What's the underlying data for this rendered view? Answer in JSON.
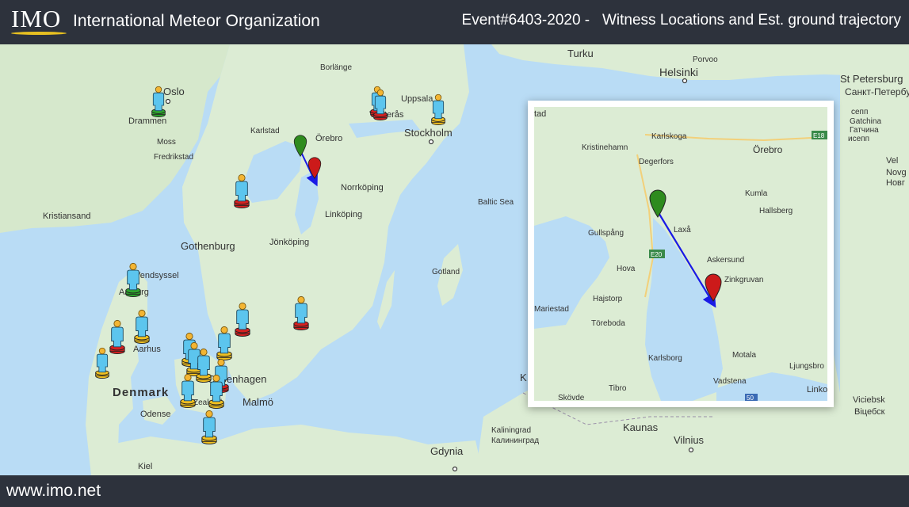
{
  "header": {
    "logo": "IMO",
    "org_name": "International Meteor Organization",
    "event_title": "Event#6403-2020 -   Witness Locations and Est. ground trajectory"
  },
  "footer": {
    "url": "www.imo.net"
  },
  "map": {
    "labels": {
      "turku": "Turku",
      "helsinki": "Helsinki",
      "porvoo": "Porvoo",
      "st_petersburg": "St Petersburg",
      "st_petersburg_ru": "Санкт-Петербург",
      "oslo": "Oslo",
      "drammen": "Drammen",
      "moss": "Moss",
      "fredrikstad": "Fredrikstad",
      "borlange": "Borlänge",
      "karlstad": "Karlstad",
      "orebro": "Örebro",
      "uppsala": "Uppsala",
      "vasteras": "Västerås",
      "stockholm": "Stockholm",
      "norrkoping": "Norrköping",
      "linkoping": "Linköping",
      "kristiansand": "Kristiansand",
      "baltic_sea": "Baltic Sea",
      "gothenburg": "Gothenburg",
      "jonkoping": "Jönköping",
      "gotland": "Gotland",
      "vendsyssel": "Vendsyssel",
      "aalborg": "Aalborg",
      "aarhus": "Aarhus",
      "denmark": "Denmark",
      "copenhagen": "Copenhagen",
      "malmo": "Malmö",
      "odense": "Odense",
      "zealand": "Zealand",
      "kiel": "Kiel",
      "gdynia": "Gdynia",
      "kaliningrad": "Kaliningrad",
      "kaliningrad_ru": "Калининград",
      "kaunas": "Kaunas",
      "vilnius": "Vilnius",
      "viciebsk": "Viciebsk",
      "viciebsk_by": "Віцебск",
      "edge_k": "K",
      "sepp": "сепп",
      "gatchina": "Gatchina",
      "gatchina_ru": "Гатчина",
      "visepp": "исепп",
      "vel": "Vel",
      "novg": "Novg",
      "novg_ru": "Новг"
    },
    "witness_colors": {
      "green": "#2ea62e",
      "red": "#d82020",
      "yellow": "#f0c020"
    }
  },
  "inset": {
    "labels": {
      "karlstad_edge": "tad",
      "karlskoga": "Karlskoga",
      "kristinehamn": "Kristinehamn",
      "degerfors": "Degerfors",
      "orebro": "Örebro",
      "kumla": "Kumla",
      "hallsberg": "Hallsberg",
      "gullspang": "Gullspång",
      "laxa": "Laxå",
      "askersund": "Askersund",
      "zinkgruvan": "Zinkgruvan",
      "hova": "Hova",
      "hajstorp": "Hajstorp",
      "mariestad": "Mariestad",
      "toreboda": "Töreboda",
      "karlsborg": "Karlsborg",
      "motala": "Motala",
      "ljungsbro": "Ljungsbro",
      "vadstena": "Vadstena",
      "tibro": "Tibro",
      "skovde": "Skövde",
      "linkoping_edge": "Linko",
      "road_e18": "E18",
      "road_e20": "E20",
      "road_50": "50"
    }
  },
  "colors": {
    "trajectory": "#1a1ae6",
    "start_marker": "#2e8b1e",
    "end_marker": "#cc1a1a",
    "water": "#b9dcf5",
    "land": "#dcecd4"
  }
}
